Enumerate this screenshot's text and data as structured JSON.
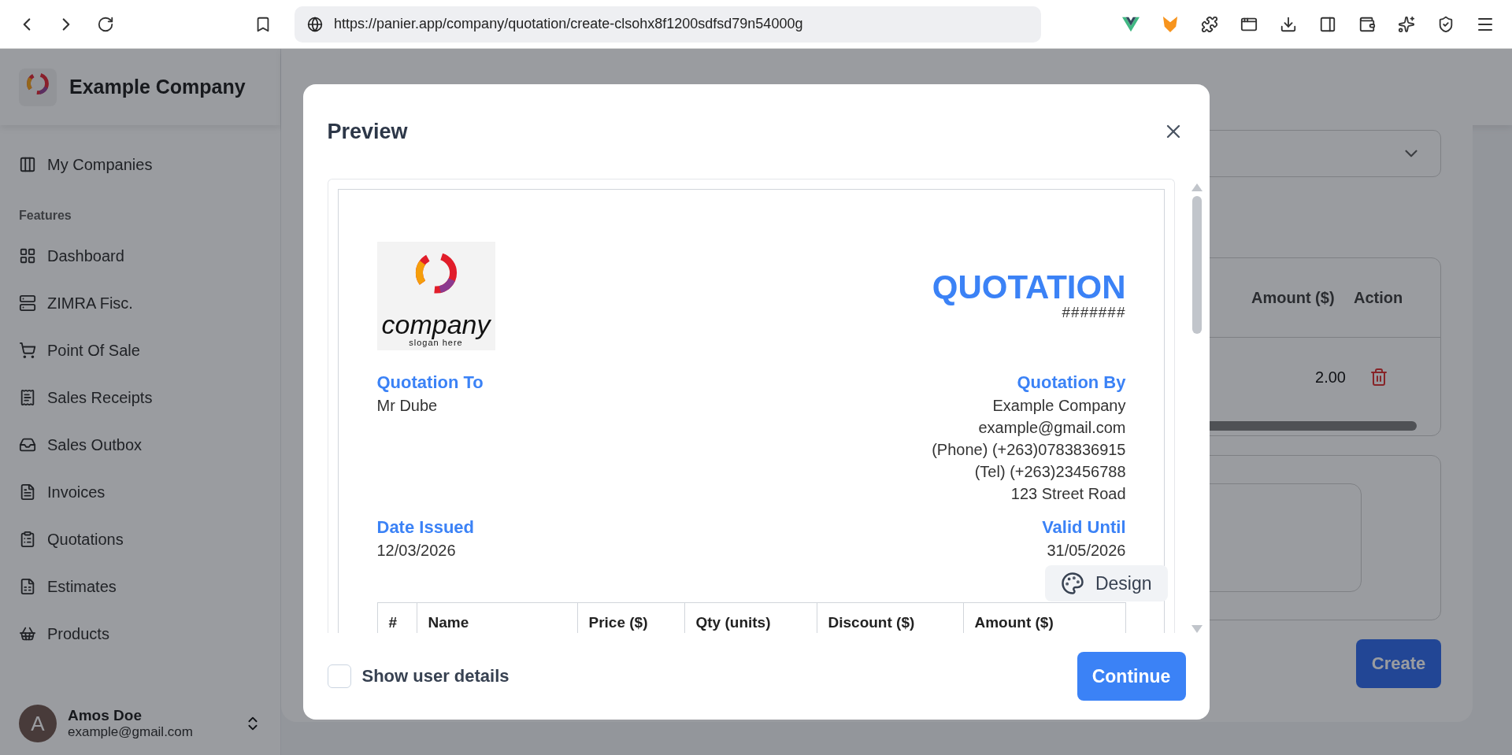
{
  "browser": {
    "url": "https://panier.app/company/quotation/create-clsohx8f1200sdfsd79n54000g"
  },
  "sidebar": {
    "company": "Example Company",
    "top_item": "My Companies",
    "section": "Features",
    "items": [
      {
        "label": "Dashboard",
        "kind": "grid"
      },
      {
        "label": "ZIMRA Fisc.",
        "kind": "server"
      },
      {
        "label": "Point Of Sale",
        "kind": "cart"
      },
      {
        "label": "Sales Receipts",
        "kind": "receipt"
      },
      {
        "label": "Sales Outbox",
        "kind": "inbox"
      },
      {
        "label": "Invoices",
        "kind": "file"
      },
      {
        "label": "Quotations",
        "kind": "clipboard"
      },
      {
        "label": "Estimates",
        "kind": "sheet"
      },
      {
        "label": "Products",
        "kind": "basket"
      }
    ],
    "user": {
      "initial": "A",
      "name": "Amos Doe",
      "email": "example@gmail.com"
    }
  },
  "background": {
    "columns": [
      "Amount ($)",
      "Action"
    ],
    "row_amount": "2.00",
    "create_button": "Create"
  },
  "modal": {
    "title": "Preview",
    "document": {
      "logo": {
        "wordmark": "company",
        "slogan": "slogan here"
      },
      "title": "QUOTATION",
      "number": "#######",
      "to": {
        "label": "Quotation To",
        "lines": [
          "Mr Dube"
        ]
      },
      "by": {
        "label": "Quotation By",
        "lines": [
          "Example Company",
          "example@gmail.com",
          "(Phone) (+263)0783836915",
          "(Tel) (+263)23456788",
          "123 Street Road"
        ]
      },
      "date_issued": {
        "label": "Date Issued",
        "value": "12/03/2026"
      },
      "valid_until": {
        "label": "Valid Until",
        "value": "31/05/2026"
      },
      "columns": [
        "#",
        "Name",
        "Price ($)",
        "Qty (units)",
        "Discount ($)",
        "Amount ($)"
      ]
    },
    "design_button": "Design",
    "show_user_details": {
      "label": "Show user details",
      "checked": false
    },
    "continue_button": "Continue"
  }
}
